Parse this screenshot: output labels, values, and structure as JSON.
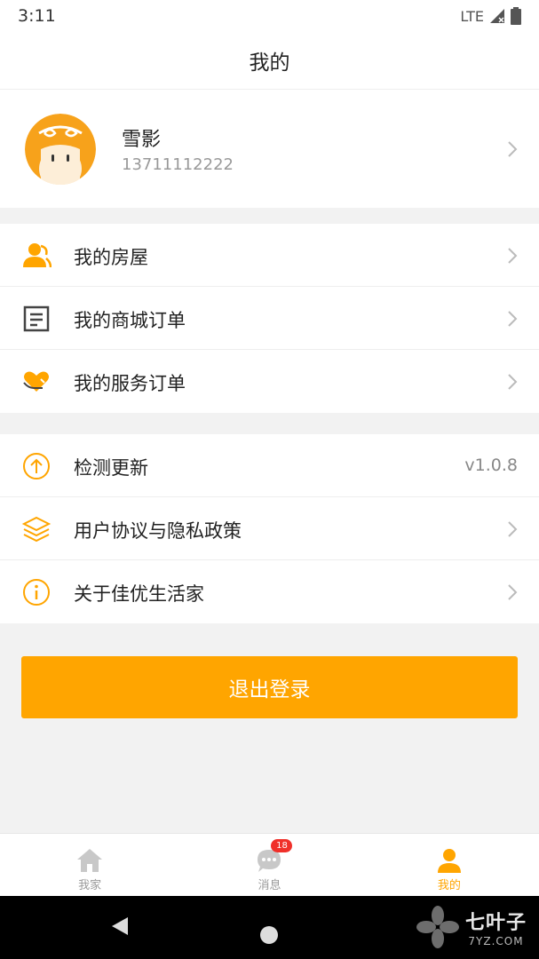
{
  "status_bar": {
    "time": "3:11",
    "network": "LTE"
  },
  "header": {
    "title": "我的"
  },
  "profile": {
    "name": "雪影",
    "phone": "13711112222"
  },
  "menu_group_1": [
    {
      "label": "我的房屋",
      "icon": "house-person-icon"
    },
    {
      "label": "我的商城订单",
      "icon": "order-list-icon"
    },
    {
      "label": "我的服务订单",
      "icon": "heart-hand-icon"
    }
  ],
  "menu_group_2": [
    {
      "label": "检测更新",
      "icon": "arrow-up-circle-icon",
      "value": "v1.0.8"
    },
    {
      "label": "用户协议与隐私政策",
      "icon": "layers-icon"
    },
    {
      "label": "关于佳优生活家",
      "icon": "info-icon"
    }
  ],
  "logout_label": "退出登录",
  "tabs": [
    {
      "label": "我家",
      "icon": "home-icon",
      "active": false
    },
    {
      "label": "消息",
      "icon": "message-icon",
      "active": false,
      "badge": "18"
    },
    {
      "label": "我的",
      "icon": "person-icon",
      "active": true
    }
  ],
  "watermark": {
    "cn": "七叶子",
    "en": "7YZ.COM"
  },
  "colors": {
    "accent": "#FFA500",
    "badge": "#F0302A",
    "text": "#222222",
    "muted": "#999999",
    "background": "#F2F2F2"
  }
}
